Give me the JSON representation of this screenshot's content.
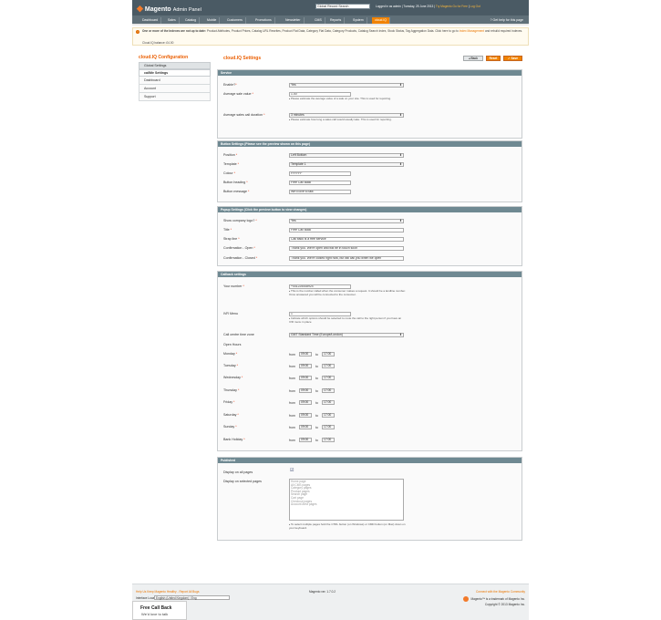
{
  "header": {
    "brand": "Magento",
    "subtitle": "Admin Panel",
    "search": "Global Record Search",
    "logged_in": "Logged in as admin",
    "date": "Tuesday, 25 June 2013",
    "try": "Try Magento Go for Free",
    "logout": "Log Out",
    "help": "Get help for this page"
  },
  "nav": [
    "Dashboard",
    "Sales",
    "Catalog",
    "Mobile",
    "Customers",
    "Promotions",
    "Newsletter",
    "CMS",
    "Reports",
    "System",
    "cloud.IQ"
  ],
  "message": {
    "bold": "One or more of the Indexes are not up to date:",
    "text": "Product Attributes, Product Prices, Catalog URL Rewrites, Product Flat Data, Category Flat Data, Category Products, Catalog Search Index, Stock Status, Tag Aggregation Data. Click here to go to",
    "link": "Index Management",
    "tail": "and rebuild required indexes.",
    "balance": "Cloud.IQ balance: £4.00"
  },
  "sidebar": {
    "title": "cloud.IQ Configuration",
    "items": [
      "Global Settings",
      "callMe Settings",
      "Dashboard",
      "Account",
      "Support"
    ]
  },
  "content": {
    "title": "cloud.IQ Settings",
    "back": "Back",
    "reset": "Reset",
    "save": "Save"
  },
  "service": {
    "header": "Service",
    "enable_label": "Enable?",
    "enable": "Yes",
    "avg_label": "Average sale value",
    "avg": "1.00",
    "avg_note": "Please estimate the average value of a sale on your site. This is used for reporting.",
    "dur_label": "Average sales call duration",
    "dur": "3 minutes",
    "dur_note": "Please estimate how long a sales call would usually take. This is used for reporting."
  },
  "button": {
    "header": "Button Settings (Please see the preview shown on this page)",
    "position_label": "Position",
    "position": "Left Bottom",
    "template_label": "Template",
    "template": "Template 1",
    "colour_label": "Colour",
    "colour": "FFFFFF",
    "heading_label": "Button heading",
    "heading": "Free Call Back",
    "message_label": "Button message",
    "message": "We'd love to talk"
  },
  "popup": {
    "header": "Popup Settings (Click the preview button to view changes)",
    "logo_label": "Show company logo?",
    "logo": "Yes",
    "title_label": "Title",
    "title": "Free Call Back",
    "strap_label": "Strap line",
    "strap": "Call back is a free service",
    "open_label": "Confirmation - Open",
    "open": "Thank you. We're open and will be in touch soon",
    "closed_label": "Confirmation - Closed",
    "closed": "Thank you. We're closed right now, but will call you when we open"
  },
  "callback": {
    "header": "Callback settings",
    "number_label": "Your number",
    "number": "+441225448924",
    "number_note": "This is the number called when the consumer makes a request. It should be a landline number. Once answered you will be connected to the consumer.",
    "ivr_label": "IVR Menu",
    "ivr": "1",
    "ivr_note": "Indicate which options should be selected to route the call to the right person if you have an IVR menu in place",
    "tz_label": "Call centre time zone",
    "tz": "GMT Standard Time (Europe/London)",
    "open_hours": "Open Hours",
    "from": "from",
    "to": "to",
    "days": [
      "Monday",
      "Tuesday",
      "Wednesday",
      "Thursday",
      "Friday",
      "Saturday",
      "Sunday",
      "Bank Holiday"
    ],
    "open_time": "09:00",
    "close_time": "17:00"
  },
  "published": {
    "header": "Published",
    "all_label": "Display on all pages",
    "sel_label": "Display on selected pages",
    "pages": [
      "Home page",
      "All CMS pages",
      "Category pages",
      "Product pages",
      "Search page",
      "Cart page",
      "Checkout pages",
      "Account Area pages"
    ],
    "note": "To select multiple pages hold the CTRL button (on Windows) or CMD button (on Mac) down on your keyboard."
  },
  "footer": {
    "help_link": "Help Us Keep Magento Healthy - Report All Bugs",
    "locale_label": "Interface Locale:",
    "locale": "English (United Kingdom) / Eng",
    "version": "Magento ver. 1.7.0.2",
    "community": "Connect with the Magento Community",
    "trademark": "Magento™ is a trademark of Magento Inc.",
    "copyright": "Copyright © 2013 Magento Inc."
  },
  "widget": {
    "title": "Free Call Back",
    "message": "We'd love to talk"
  }
}
